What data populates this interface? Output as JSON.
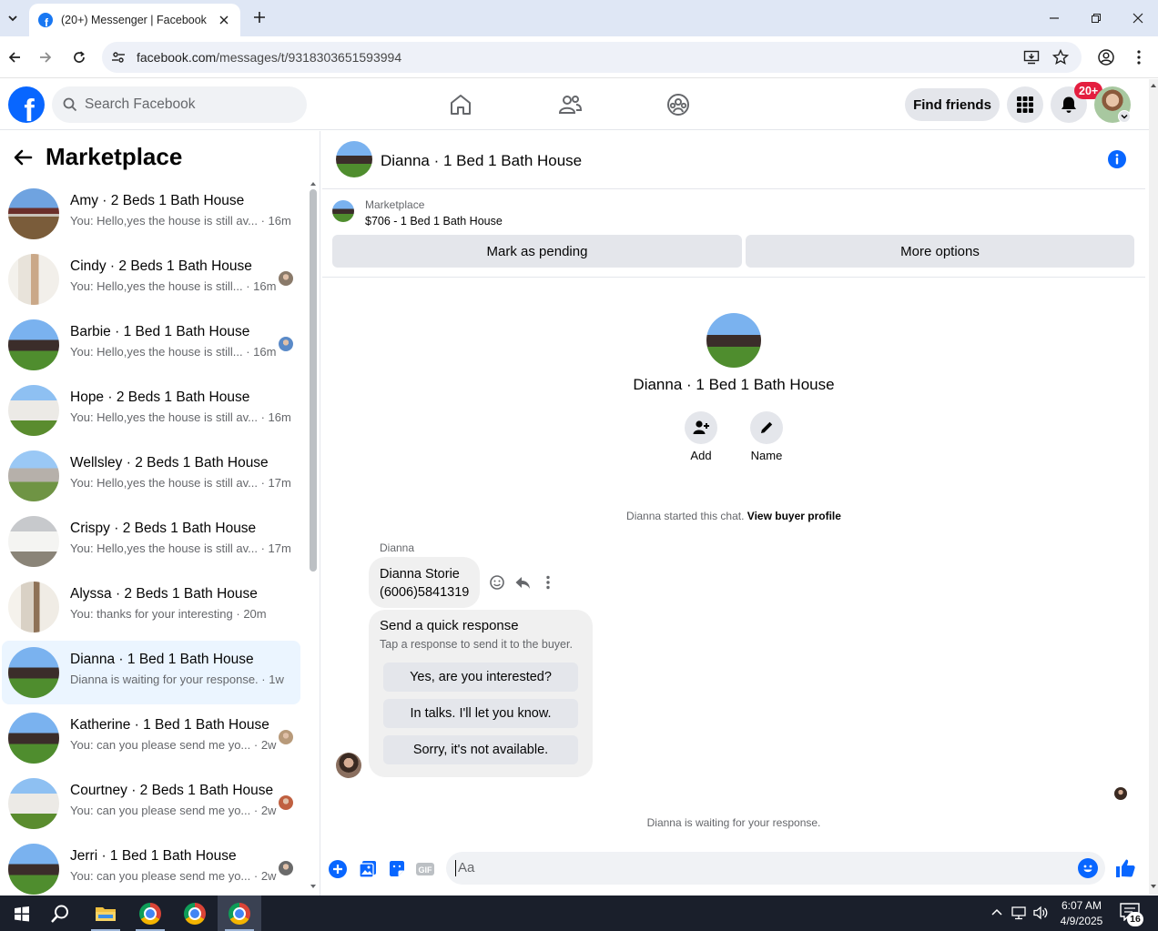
{
  "browser": {
    "tab_title": "(20+) Messenger | Facebook",
    "url_host": "facebook.com",
    "url_path": "/messages/t/9318303651593994"
  },
  "fb_header": {
    "search_placeholder": "Search Facebook",
    "find_friends_label": "Find friends",
    "notification_badge": "20+"
  },
  "sidebar": {
    "title": "Marketplace",
    "conversations": [
      {
        "name": "Amy · 2 Beds 1 Bath House",
        "snippet": "You: Hello,yes the house is still av...",
        "time": "16m",
        "thumb": "house1",
        "active": false
      },
      {
        "name": "Cindy · 2 Beds 1 Bath House",
        "snippet": "You: Hello,yes the house is still...",
        "time": "16m",
        "thumb": "house2",
        "active": false
      },
      {
        "name": "Barbie · 1 Bed 1 Bath House",
        "snippet": "You: Hello,yes the house is still...",
        "time": "16m",
        "thumb": "house3",
        "active": false
      },
      {
        "name": "Hope · 2 Beds 1 Bath House",
        "snippet": "You: Hello,yes the house is still av...",
        "time": "16m",
        "thumb": "house4",
        "active": false
      },
      {
        "name": "Wellsley · 2 Beds 1 Bath House",
        "snippet": "You: Hello,yes the house is still av...",
        "time": "17m",
        "thumb": "house5",
        "active": false
      },
      {
        "name": "Crispy · 2 Beds 1 Bath House",
        "snippet": "You: Hello,yes the house is still av...",
        "time": "17m",
        "thumb": "house6",
        "active": false
      },
      {
        "name": "Alyssa · 2 Beds 1 Bath House",
        "snippet": "You: thanks for your interesting",
        "time": "20m",
        "thumb": "house7",
        "active": false
      },
      {
        "name": "Dianna · 1 Bed 1 Bath House",
        "snippet": "Dianna is waiting for your response.",
        "time": "1w",
        "thumb": "house3",
        "active": true
      },
      {
        "name": "Katherine · 1 Bed 1 Bath House",
        "snippet": "You: can you please send me yo...",
        "time": "2w",
        "thumb": "house3",
        "active": false
      },
      {
        "name": "Courtney · 2 Beds 1 Bath House",
        "snippet": "You: can you please send me yo...",
        "time": "2w",
        "thumb": "house4",
        "active": false
      },
      {
        "name": "Jerri · 1 Bed 1 Bath House",
        "snippet": "You: can you please send me yo...",
        "time": "2w",
        "thumb": "house3",
        "active": false
      }
    ]
  },
  "chat": {
    "title": "Dianna · 1 Bed 1 Bath House",
    "marketplace_label": "Marketplace",
    "listing_price_title": "$706 - 1 Bed 1 Bath House",
    "mark_pending_label": "Mark as pending",
    "more_options_label": "More options",
    "profile_name": "Dianna · 1 Bed 1 Bath House",
    "add_label": "Add",
    "name_label": "Name",
    "started_text": "Dianna started this chat.",
    "view_profile_link": "View buyer profile",
    "sender_name": "Dianna",
    "message_line1": "Dianna Storie",
    "message_line2": "(6006)5841319",
    "quick_title": "Send a quick response",
    "quick_subtitle": "Tap a response to send it to the buyer.",
    "quick_responses": [
      "Yes, are you interested?",
      "In talks. I'll let you know.",
      "Sorry, it's not available."
    ],
    "waiting_text": "Dianna is waiting for your response.",
    "composer_placeholder": "Aa"
  },
  "taskbar": {
    "time": "6:07 AM",
    "date": "4/9/2025",
    "notification_count": "16"
  },
  "colors": {
    "fb_blue": "#0866ff",
    "active_row": "#ebf5ff",
    "badge_red": "#e41e3f"
  }
}
